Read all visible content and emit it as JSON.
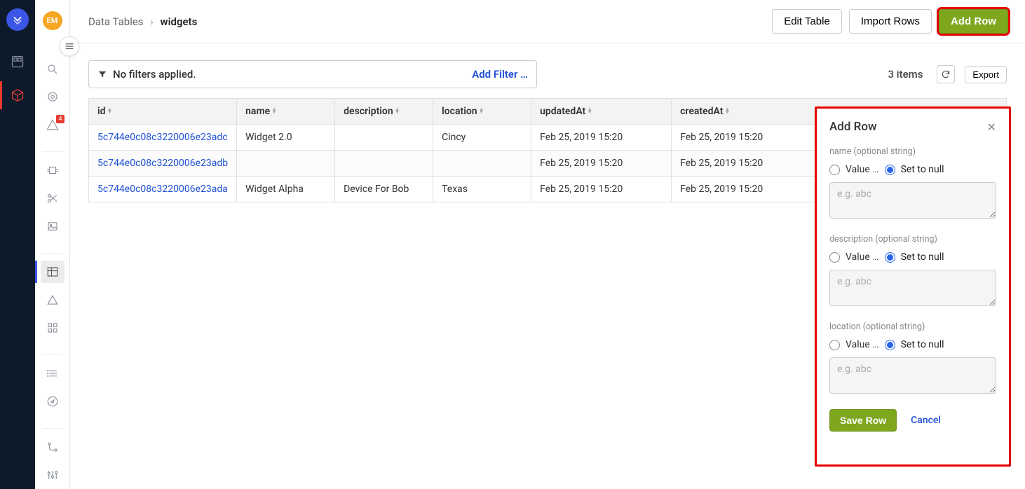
{
  "avatar_initials": "EM",
  "alert_badge": "4",
  "breadcrumb": {
    "root": "Data Tables",
    "sep": "›",
    "current": "widgets"
  },
  "topbar": {
    "edit_table": "Edit Table",
    "import_rows": "Import Rows",
    "add_row": "Add Row"
  },
  "filter": {
    "none_text": "No filters applied.",
    "add_filter": "Add Filter …"
  },
  "result_meta": {
    "count_text": "3 items",
    "export": "Export"
  },
  "columns": [
    "id",
    "name",
    "description",
    "location",
    "updatedAt",
    "createdAt"
  ],
  "rows": [
    {
      "id": "5c744e0c08c3220006e23adc",
      "name": "Widget 2.0",
      "description": "",
      "location": "Cincy",
      "updatedAt": "Feb 25, 2019 15:20",
      "createdAt": "Feb 25, 2019 15:20"
    },
    {
      "id": "5c744e0c08c3220006e23adb",
      "name": "",
      "description": "",
      "location": "",
      "updatedAt": "Feb 25, 2019 15:20",
      "createdAt": "Feb 25, 2019 15:20"
    },
    {
      "id": "5c744e0c08c3220006e23ada",
      "name": "Widget Alpha",
      "description": "Device For Bob",
      "location": "Texas",
      "updatedAt": "Feb 25, 2019 15:20",
      "createdAt": "Feb 25, 2019 15:20"
    }
  ],
  "panel": {
    "title": "Add Row",
    "fields": {
      "name": {
        "label": "name (optional string)",
        "value_label": "Value …",
        "null_label": "Set to null",
        "placeholder": "e.g. abc"
      },
      "description": {
        "label": "description (optional string)",
        "value_label": "Value …",
        "null_label": "Set to null",
        "placeholder": "e.g. abc"
      },
      "location": {
        "label": "location (optional string)",
        "value_label": "Value …",
        "null_label": "Set to null",
        "placeholder": "e.g. abc"
      }
    },
    "save": "Save Row",
    "cancel": "Cancel"
  }
}
